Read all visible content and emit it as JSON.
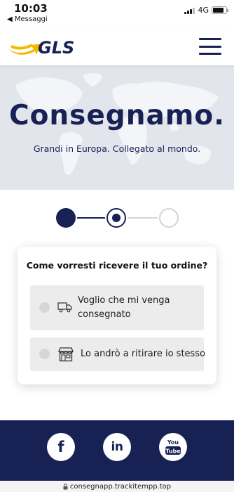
{
  "status_bar": {
    "time": "10:03",
    "back_label": "◀ Messaggi",
    "network": "4G"
  },
  "header": {
    "logo_text": "GLS",
    "menu_icon": "hamburger-menu-icon"
  },
  "hero": {
    "title": "Consegnamo.",
    "subtitle": "Grandi in Europa. Collegato al mondo."
  },
  "stepper": {
    "total_steps": 3,
    "current_step": 2
  },
  "delivery_choice": {
    "question": "Come vorresti ricevere il tuo ordine?",
    "options": [
      {
        "label": "Voglio che mi venga consegnato",
        "icon": "delivery-truck-icon"
      },
      {
        "label": "Lo andrò a ritirare io stesso",
        "icon": "shop-icon"
      }
    ]
  },
  "footer": {
    "social": [
      {
        "name": "facebook",
        "glyph": "f"
      },
      {
        "name": "linkedin",
        "glyph": "in"
      },
      {
        "name": "youtube",
        "glyph": "You Tube"
      }
    ]
  },
  "browser": {
    "url": "consegnapp.trackitempp.top"
  },
  "colors": {
    "brand_navy": "#172154",
    "brand_yellow": "#f6b800",
    "hero_bg": "#e3e5ed",
    "option_bg": "#ececec"
  }
}
